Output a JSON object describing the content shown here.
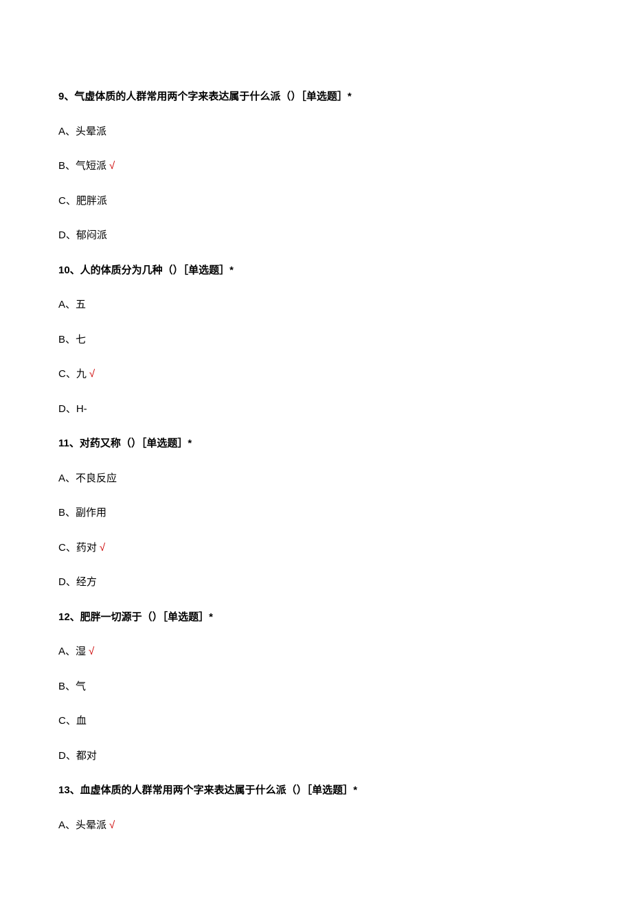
{
  "questions": [
    {
      "number": "9、",
      "text": "气虚体质的人群常用两个字来表达属于什么派（）［单选题］*",
      "options": [
        {
          "label": "A、",
          "text": "头晕派",
          "correct": false
        },
        {
          "label": "B、",
          "text": "气短派",
          "correct": true
        },
        {
          "label": "C、",
          "text": "肥胖派",
          "correct": false
        },
        {
          "label": "D、",
          "text": "郁闷派",
          "correct": false
        }
      ]
    },
    {
      "number": "10、",
      "text": "人的体质分为几种（）［单选题］*",
      "options": [
        {
          "label": "A、",
          "text": "五",
          "correct": false
        },
        {
          "label": "B、",
          "text": "七",
          "correct": false
        },
        {
          "label": "C、",
          "text": "九",
          "correct": true
        },
        {
          "label": "D、",
          "text": "H-",
          "correct": false
        }
      ]
    },
    {
      "number": "11、",
      "text": "对药又称（）［单选题］*",
      "options": [
        {
          "label": "A、",
          "text": "不良反应",
          "correct": false
        },
        {
          "label": "B、",
          "text": "副作用",
          "correct": false
        },
        {
          "label": "C、",
          "text": "药对",
          "correct": true
        },
        {
          "label": "D、",
          "text": "经方",
          "correct": false
        }
      ]
    },
    {
      "number": "12、",
      "text": "肥胖一切源于（）［单选题］*",
      "options": [
        {
          "label": "A、",
          "text": "湿",
          "correct": true
        },
        {
          "label": "B、",
          "text": "气",
          "correct": false
        },
        {
          "label": "C、",
          "text": "血",
          "correct": false
        },
        {
          "label": "D、",
          "text": "都对",
          "correct": false
        }
      ]
    },
    {
      "number": "13、",
      "text": "血虚体质的人群常用两个字来表达属于什么派（）［单选题］*",
      "options": [
        {
          "label": "A、",
          "text": "头晕派",
          "correct": true
        }
      ]
    }
  ],
  "check_mark": "√"
}
